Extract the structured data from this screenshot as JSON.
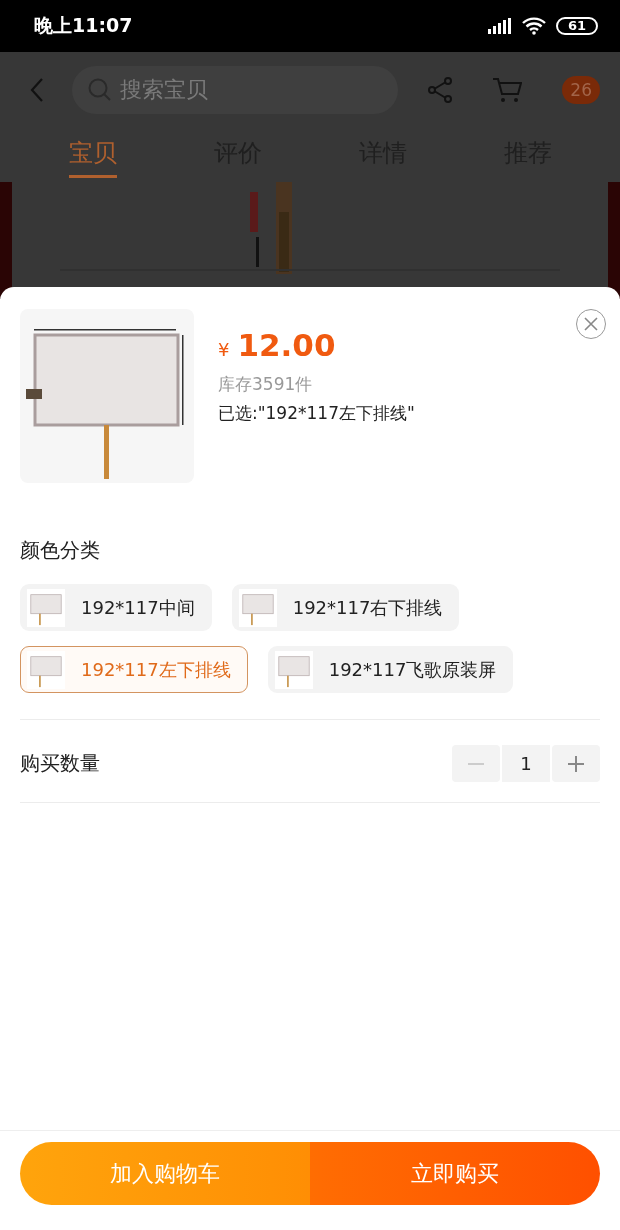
{
  "status_bar": {
    "time": "晚上11:07",
    "battery": "61"
  },
  "nav": {
    "search": {
      "placeholder": "搜索宝贝"
    },
    "badge": "26"
  },
  "tabs": [
    {
      "label": "宝贝",
      "selected": true
    },
    {
      "label": "评价",
      "selected": false
    },
    {
      "label": "详情",
      "selected": false
    },
    {
      "label": "推荐",
      "selected": false
    }
  ],
  "sheet": {
    "price": {
      "currency": "¥",
      "amount": "12.00"
    },
    "stock": "库存3591件",
    "selection": "已选:\"192*117左下排线\"",
    "section_title": "颜色分类",
    "options": [
      {
        "label": "192*117中间",
        "selected": false
      },
      {
        "label": "192*117右下排线",
        "selected": false
      },
      {
        "label": "192*117左下排线",
        "selected": true
      },
      {
        "label": "192*117飞歌原装屏",
        "selected": false
      }
    ],
    "quantity": {
      "label": "购买数量",
      "value": "1",
      "decrease_disabled": true
    }
  },
  "buttons": [
    {
      "label": "加入购物车",
      "kind": "cart"
    },
    {
      "label": "立即购买",
      "kind": "buy"
    }
  ]
}
